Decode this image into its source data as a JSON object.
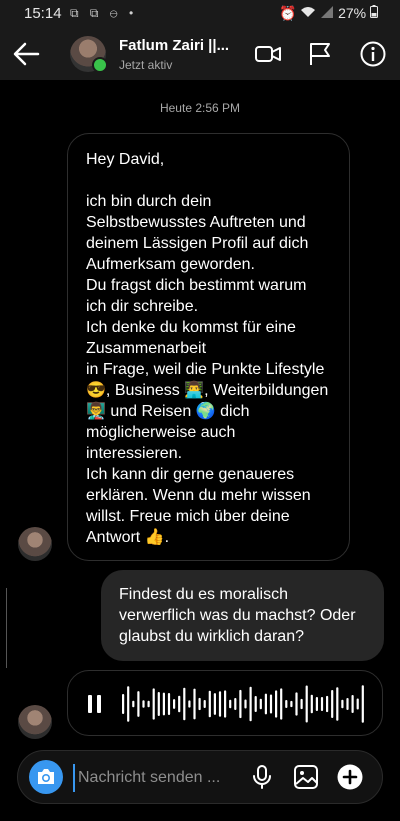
{
  "status_bar": {
    "time": "15:14",
    "left_icons": "⧉ ⧉ ⊖ •",
    "right_text": "27%"
  },
  "header": {
    "name": "Fatlum Zairi ||...",
    "status": "Jetzt aktiv"
  },
  "timestamp": "Heute 2:56 PM",
  "messages": {
    "incoming_text": "Hey David,\n\nich bin durch dein Selbstbewusstes Auftreten und deinem Lässigen Profil auf dich Aufmerksam geworden.\nDu fragst dich bestimmt warum ich dir schreibe.\nIch denke du kommst für eine Zusammenarbeit\nin Frage, weil die Punkte Lifestyle 😎, Business 👨‍💻, Weiterbildungen👨‍🏫 und Reisen 🌍 dich möglicherweise auch interessieren.\nIch kann dir gerne genaueres erklären. Wenn du mehr wissen willst. Freue mich über deine Antwort 👍.",
    "outgoing_text": "Findest du es moralisch verwerflich was du machst? Oder glaubst du wirklich daran?"
  },
  "composer": {
    "placeholder": "Nachricht senden ..."
  },
  "colors": {
    "accent": "#3897f0",
    "online": "#39c34a",
    "bubble_out": "#262626",
    "bubble_border": "#2e2e2e"
  },
  "icons": [
    "back-arrow-icon",
    "video-call-icon",
    "flag-icon",
    "info-icon",
    "pause-icon",
    "camera-icon",
    "microphone-icon",
    "gallery-icon",
    "plus-icon",
    "alarm-icon",
    "wifi-icon",
    "signal-icon",
    "battery-icon"
  ]
}
